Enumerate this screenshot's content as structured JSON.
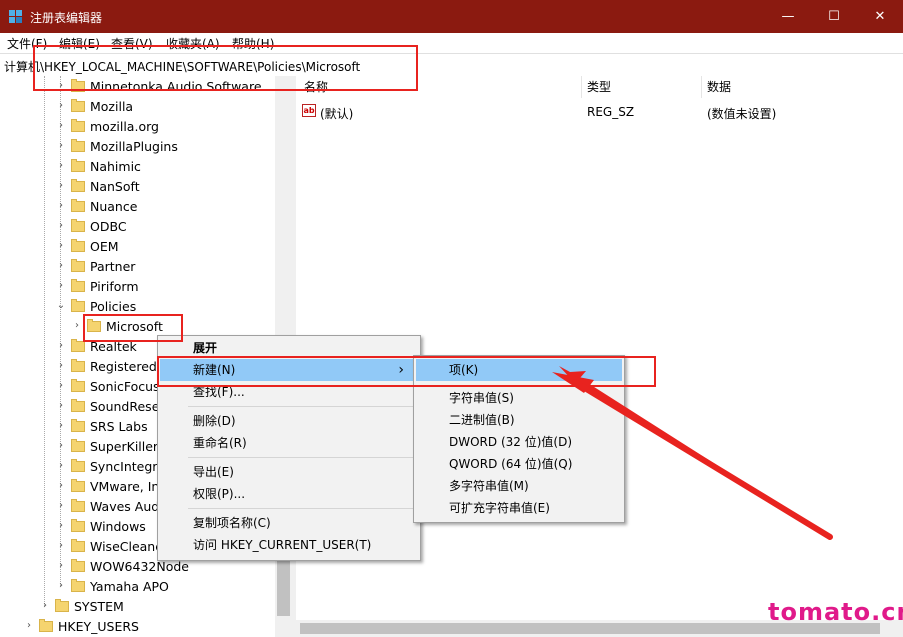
{
  "window": {
    "title": "注册表编辑器",
    "minimize_glyph": "—",
    "maximize_glyph": "☐",
    "close_glyph": "✕",
    "title_bar_color": "#8b1a10"
  },
  "menu": [
    "文件(F)",
    "编辑(E)",
    "查看(V)",
    "收藏夹(A)",
    "帮助(H)"
  ],
  "address": "计算机\\HKEY_LOCAL_MACHINE\\SOFTWARE\\Policies\\Microsoft",
  "tree": {
    "items": [
      {
        "label": "Minnetonka Audio Software",
        "expanded": false
      },
      {
        "label": "Mozilla",
        "expanded": false
      },
      {
        "label": "mozilla.org",
        "expanded": false
      },
      {
        "label": "MozillaPlugins",
        "expanded": false
      },
      {
        "label": "Nahimic",
        "expanded": false
      },
      {
        "label": "NanSoft",
        "expanded": false
      },
      {
        "label": "Nuance",
        "expanded": false
      },
      {
        "label": "ODBC",
        "expanded": false
      },
      {
        "label": "OEM",
        "expanded": false
      },
      {
        "label": "Partner",
        "expanded": false
      },
      {
        "label": "Piriform",
        "expanded": false
      },
      {
        "label": "Policies",
        "expanded": true
      },
      {
        "label": "Microsoft",
        "expanded": false,
        "selected": true
      },
      {
        "label": "Realtek",
        "expanded": false
      },
      {
        "label": "RegisteredA",
        "expanded": false
      },
      {
        "label": "SonicFocus",
        "expanded": false
      },
      {
        "label": "SoundResea",
        "expanded": false
      },
      {
        "label": "SRS Labs",
        "expanded": false
      },
      {
        "label": "SuperKiller",
        "expanded": false
      },
      {
        "label": "SyncIntegra",
        "expanded": false
      },
      {
        "label": "VMware, Inc",
        "expanded": false
      },
      {
        "label": "Waves Audi",
        "expanded": false
      },
      {
        "label": "Windows",
        "expanded": false
      },
      {
        "label": "WiseCleane",
        "expanded": false
      },
      {
        "label": "WOW6432Node",
        "expanded": false
      },
      {
        "label": "Yamaha APO",
        "expanded": false
      },
      {
        "label": "SYSTEM",
        "expanded": false
      },
      {
        "label": "HKEY_USERS",
        "expanded": false
      }
    ]
  },
  "values": {
    "headers": {
      "name": "名称",
      "type": "类型",
      "data": "数据"
    },
    "rows": [
      {
        "icon": "ab",
        "name": "(默认)",
        "type": "REG_SZ",
        "data": "(数值未设置)"
      }
    ]
  },
  "context_menu": {
    "items": [
      "展开",
      "新建(N)",
      "查找(F)...",
      "删除(D)",
      "重命名(R)",
      "导出(E)",
      "权限(P)...",
      "复制项名称(C)",
      "访问 HKEY_CURRENT_USER(T)"
    ],
    "submenu_arrow": "›"
  },
  "submenu": {
    "items": [
      "项(K)",
      "字符串值(S)",
      "二进制值(B)",
      "DWORD (32 位)值(D)",
      "QWORD (64 位)值(Q)",
      "多字符串值(M)",
      "可扩充字符串值(E)"
    ]
  },
  "watermark": "tomato.cm",
  "annotation_color": "#e8231f",
  "highlight_color": "#91c9f7"
}
